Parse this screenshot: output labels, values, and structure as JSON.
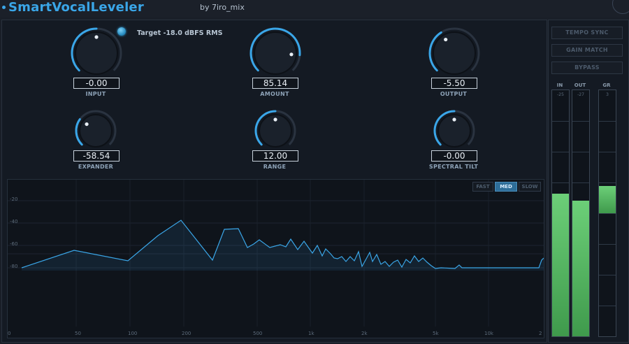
{
  "app": {
    "title": "SmartVocalLeveler",
    "byline": "by 7iro_mix"
  },
  "target": {
    "text": "Target  -18.0 dBFS RMS"
  },
  "knobs": [
    {
      "label": "INPUT",
      "value": "-0.00",
      "level": 0.5
    },
    {
      "label": "AMOUNT",
      "value": "85.14",
      "level": 0.85
    },
    {
      "label": "OUTPUT",
      "value": "-5.50",
      "level": 0.38
    },
    {
      "label": "EXPANDER",
      "value": "-58.54",
      "level": 0.3
    },
    {
      "label": "RANGE",
      "value": "12.00",
      "level": 0.5
    },
    {
      "label": "SPECTRAL TILT",
      "value": "-0.00",
      "level": 0.5
    }
  ],
  "spectrum": {
    "speed_buttons": [
      {
        "label": "FAST",
        "active": false
      },
      {
        "label": "MED",
        "active": true
      },
      {
        "label": "SLOW",
        "active": false
      }
    ],
    "db_labels": [
      "-20",
      "-40",
      "-60",
      "-80"
    ],
    "freq_labels": [
      "0",
      "50",
      "100",
      "200",
      "500",
      "1k",
      "2k",
      "5k",
      "10k",
      "2"
    ]
  },
  "side": {
    "buttons": [
      "TEMPO SYNC",
      "GAIN MATCH",
      "BYPASS"
    ],
    "meters": [
      {
        "label": "IN",
        "value": "-25",
        "level": 0.58
      },
      {
        "label": "OUT",
        "value": "-27",
        "level": 0.55
      },
      {
        "label": "GR",
        "value": "3",
        "level": 0.11
      }
    ]
  },
  "colors": {
    "accent": "#3aa6e8",
    "meter_green": "#5fc86a",
    "panel": "#141a23"
  }
}
